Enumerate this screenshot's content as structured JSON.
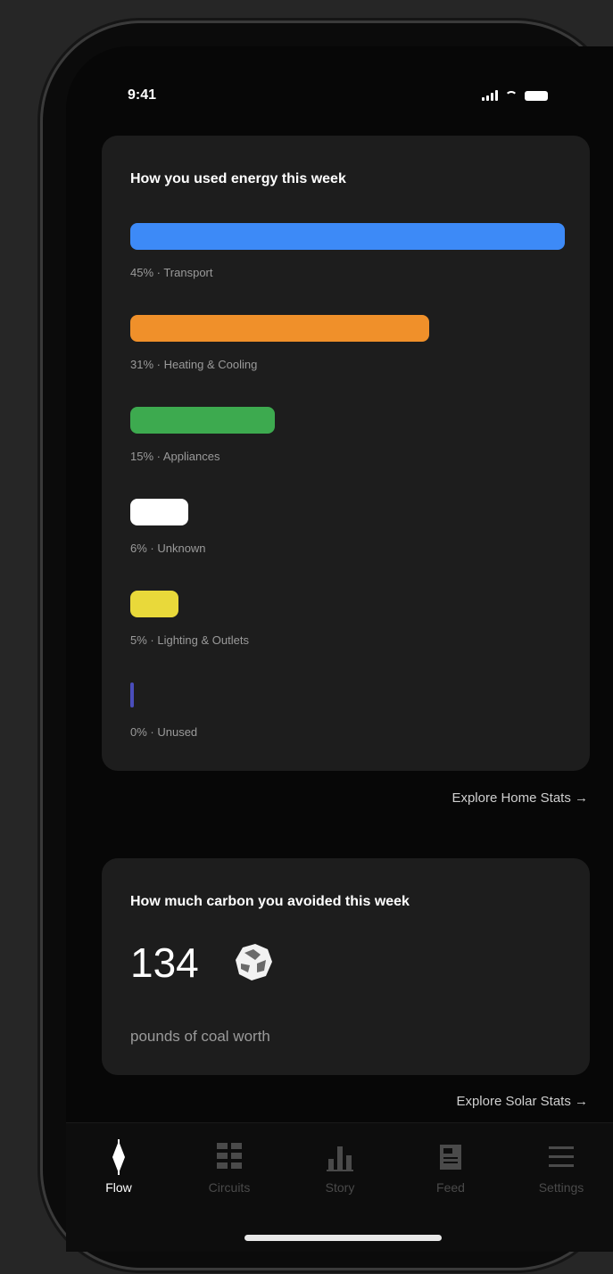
{
  "status": {
    "time": "9:41"
  },
  "energy_card": {
    "title": "How you used energy this week",
    "items": [
      {
        "label": "45% · Transport",
        "percent": 45,
        "color": "#3d8af7"
      },
      {
        "label": "31% · Heating & Cooling",
        "percent": 31,
        "color": "#f0902a"
      },
      {
        "label": "15% · Appliances",
        "percent": 15,
        "color": "#3daa4f"
      },
      {
        "label": "6% · Unknown",
        "percent": 6,
        "color": "#ffffff"
      },
      {
        "label": "5% · Lighting & Outlets",
        "percent": 5,
        "color": "#e9d93a"
      },
      {
        "label": "0% · Unused",
        "percent": 0,
        "color": "#4a4dbb"
      }
    ],
    "explore_label": "Explore Home Stats →"
  },
  "carbon_card": {
    "title": "How much carbon you avoided this week",
    "value": "134",
    "icon": "coal-icon",
    "unit_text": "pounds of coal worth",
    "explore_label": "Explore Solar Stats →"
  },
  "tabs": [
    {
      "label": "Flow",
      "icon": "flow-icon",
      "active": true
    },
    {
      "label": "Circuits",
      "icon": "circuits-icon",
      "active": false
    },
    {
      "label": "Story",
      "icon": "story-icon",
      "active": false
    },
    {
      "label": "Feed",
      "icon": "feed-icon",
      "active": false
    },
    {
      "label": "Settings",
      "icon": "settings-icon",
      "active": false
    }
  ]
}
